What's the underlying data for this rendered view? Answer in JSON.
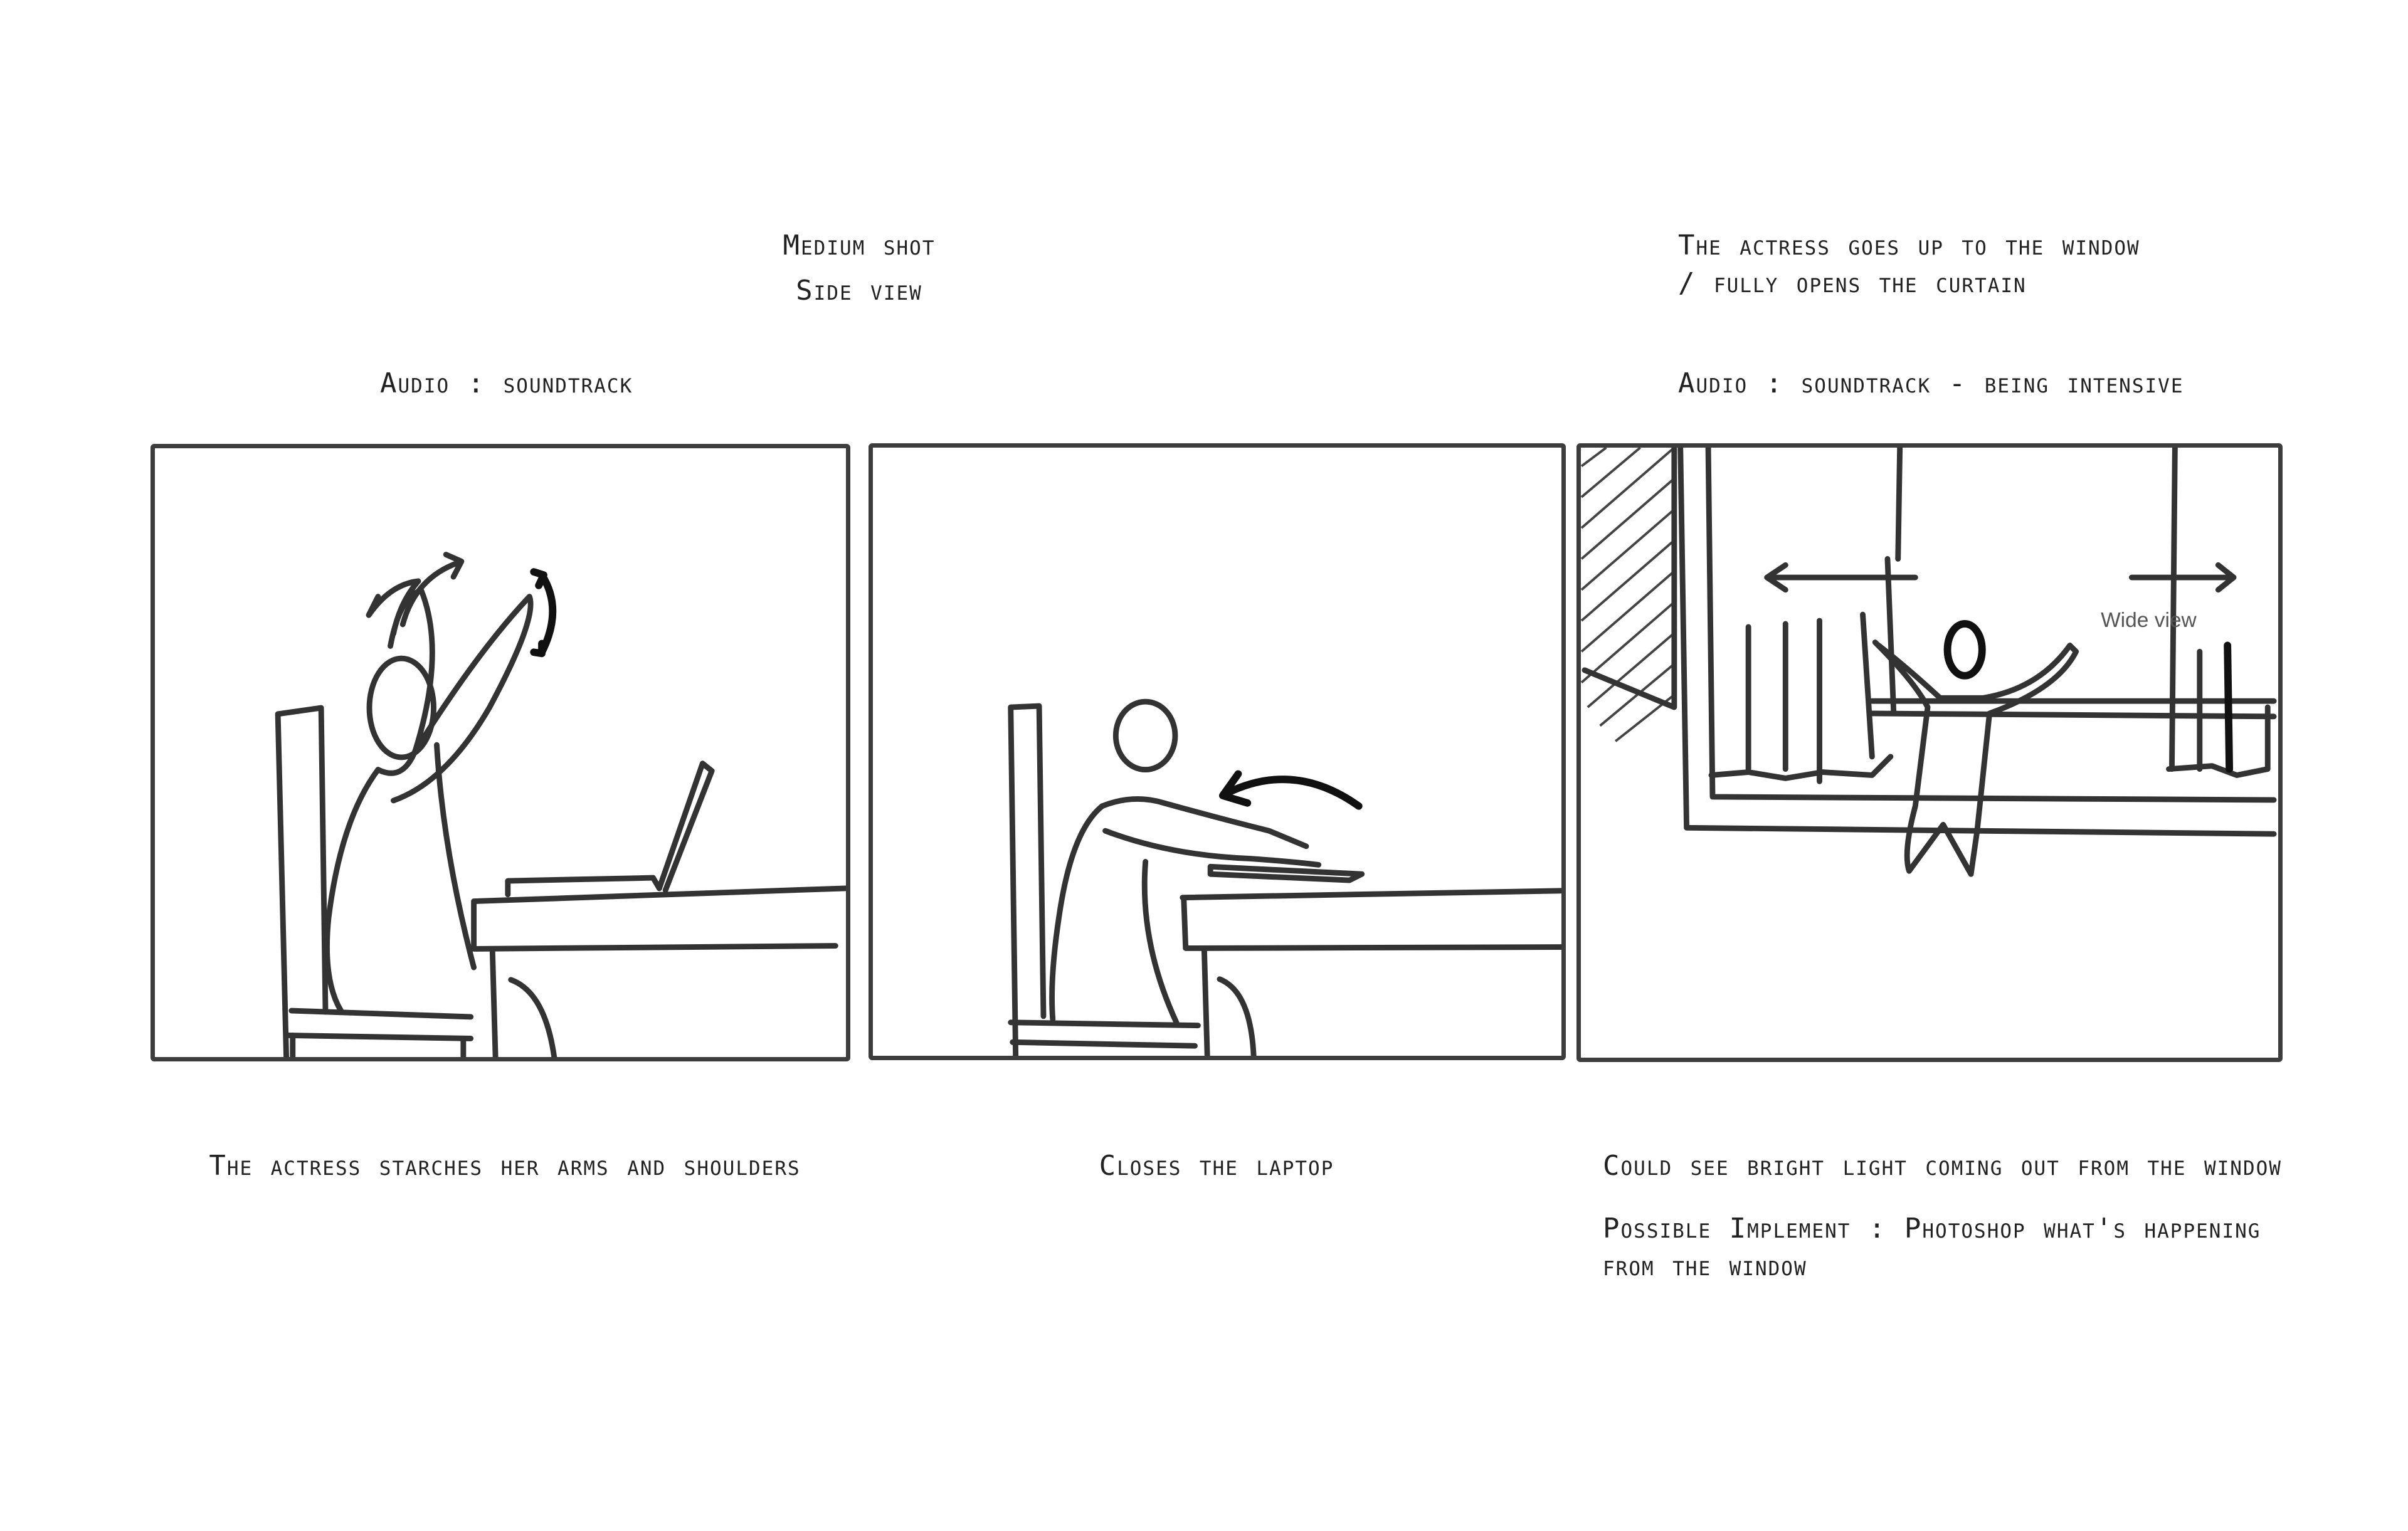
{
  "panel1": {
    "audio": "Audio : soundtrack",
    "action": "The actress starches her arms and shoulders"
  },
  "panel2": {
    "shot_line1": "Medium shot",
    "shot_line2": "Side view",
    "action": "Closes the laptop"
  },
  "panel3": {
    "action_line1": "The actress goes up to the window",
    "action_line2": "/ fully opens the curtain",
    "audio": "Audio : soundtrack - being intensive",
    "view_label": "Wide view",
    "note1": "Could see bright light coming out from the window",
    "note2_line1": "Possible Implement : Photoshop what's happening",
    "note2_line2": "from the window"
  },
  "colors": {
    "ink": "#333333",
    "frame": "#3d3d3d",
    "paper": "#ffffff"
  },
  "icons": [
    "stretch-arrow-icon",
    "curved-arrow-icon",
    "double-arrow-icon"
  ]
}
